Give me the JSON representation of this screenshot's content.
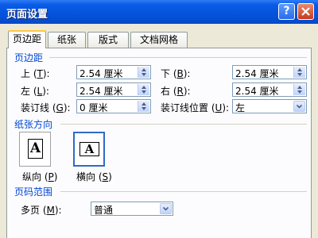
{
  "window": {
    "title": "页面设置"
  },
  "tabs": [
    {
      "label": "页边距",
      "active": true
    },
    {
      "label": "纸张",
      "active": false
    },
    {
      "label": "版式",
      "active": false
    },
    {
      "label": "文档网格",
      "active": false
    }
  ],
  "margins": {
    "section_title": "页边距",
    "top": {
      "label": "上",
      "key": "T",
      "value": "2.54 厘米"
    },
    "bottom": {
      "label": "下",
      "key": "B",
      "value": "2.54 厘米"
    },
    "left": {
      "label": "左",
      "key": "L",
      "value": "2.54 厘米"
    },
    "right": {
      "label": "右",
      "key": "R",
      "value": "2.54 厘米"
    },
    "gutter": {
      "label": "装订线",
      "key": "G",
      "value": "0 厘米"
    },
    "gutter_pos": {
      "label": "装订线位置",
      "key": "U",
      "value": "左"
    }
  },
  "orientation": {
    "section_title": "纸张方向",
    "portrait": {
      "label": "纵向",
      "key": "P",
      "glyph": "A"
    },
    "landscape": {
      "label": "横向",
      "key": "S",
      "glyph": "A",
      "selected": true
    }
  },
  "pages": {
    "section_title": "页码范围",
    "multiple": {
      "label": "多页",
      "key": "M",
      "value": "普通"
    }
  }
}
